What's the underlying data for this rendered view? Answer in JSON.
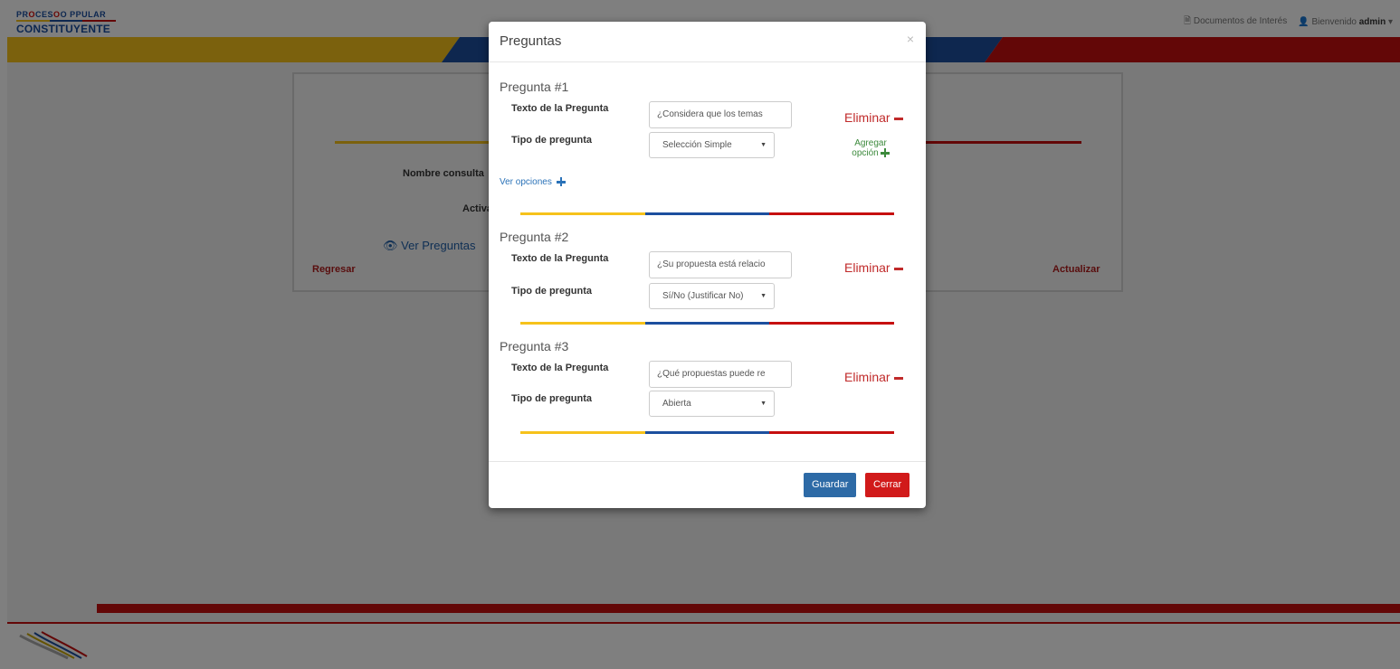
{
  "colors": {
    "yellow": "#f6c21b",
    "blue": "#1c4f9e",
    "red": "#c60f0f"
  },
  "header": {
    "logo_line1_a": "PR",
    "logo_line1_o": "O",
    "logo_line1_b": "CES",
    "logo_line1_c": "O P",
    "logo_line1_o2": "O",
    "logo_line1_d": "PULAR",
    "logo_line2": "CONSTITUYENTE",
    "docs_link": "Documentos de Interés",
    "welcome": "Bienvenido",
    "user": "admin",
    "user_caret": "▾"
  },
  "panel": {
    "nombre_label": "Nombre consulta",
    "activa_label": "Activa",
    "ver_preguntas": "Ver Preguntas",
    "regresar": "Regresar",
    "actualizar": "Actualizar"
  },
  "modal": {
    "title": "Preguntas",
    "close": "×",
    "text_label": "Texto de la Pregunta",
    "type_label": "Tipo de pregunta",
    "delete_label": "Eliminar",
    "add_option_line1": "Agregar",
    "add_option_line2": "opción",
    "ver_opciones": "Ver opciones",
    "questions": [
      {
        "title": "Pregunta #1",
        "text": "¿Considera que los temas",
        "type": "Selección Simple"
      },
      {
        "title": "Pregunta #2",
        "text": "¿Su propuesta está relacio",
        "type": "Sí/No (Justificar No)"
      },
      {
        "title": "Pregunta #3",
        "text": "¿Qué propuestas puede re",
        "type": "Abierta"
      }
    ],
    "save_label": "Guardar",
    "close_label": "Cerrar"
  }
}
